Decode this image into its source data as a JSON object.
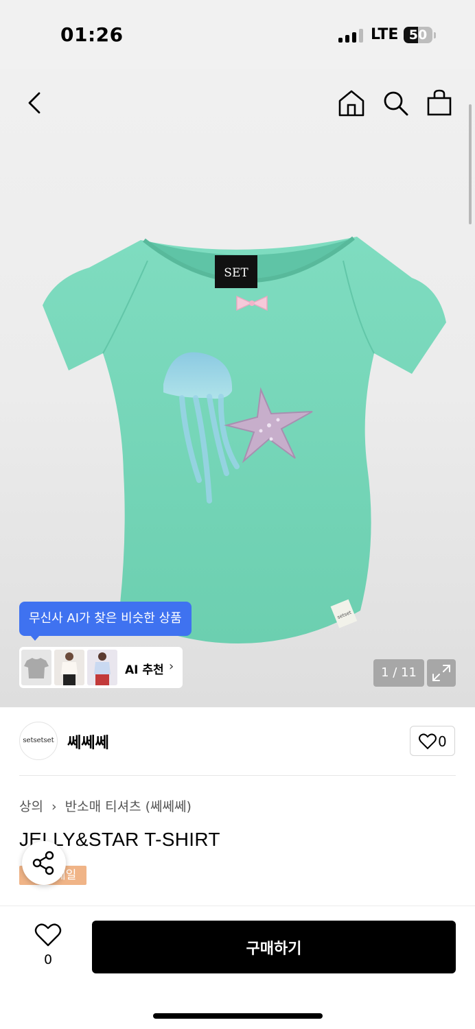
{
  "status_bar": {
    "time": "01:26",
    "network": "LTE",
    "battery": "50",
    "battery_level": 0.5
  },
  "nav": {
    "back_icon": "chevron-left-icon",
    "home_icon": "home-icon",
    "search_icon": "search-icon",
    "cart_icon": "shopping-bag-icon"
  },
  "product_image": {
    "ai_bubble_text": "무신사 AI가 찾은 비슷한 상품",
    "ai_recommend_label": "AI 추천",
    "ai_recommend_chevron": "›",
    "page_counter": "1 / 11",
    "tag_text": "SET",
    "care_label_text": "setset"
  },
  "brand": {
    "logo_text": "setsetset",
    "name": "쎄쎄쎄",
    "like_count": "0"
  },
  "breadcrumb": {
    "category": "상의",
    "separator": "›",
    "subcategory": "반소매 티셔츠 (쎄쎄쎄)"
  },
  "product": {
    "title": "JELLY&STAR T-SHIRT",
    "badge": "세일"
  },
  "bottom_bar": {
    "favorite_count": "0",
    "buy_label": "구매하기"
  },
  "colors": {
    "accent_blue": "#3f72f0",
    "sale_orange": "#f0b487",
    "shirt_mint": "#7fd9be"
  }
}
